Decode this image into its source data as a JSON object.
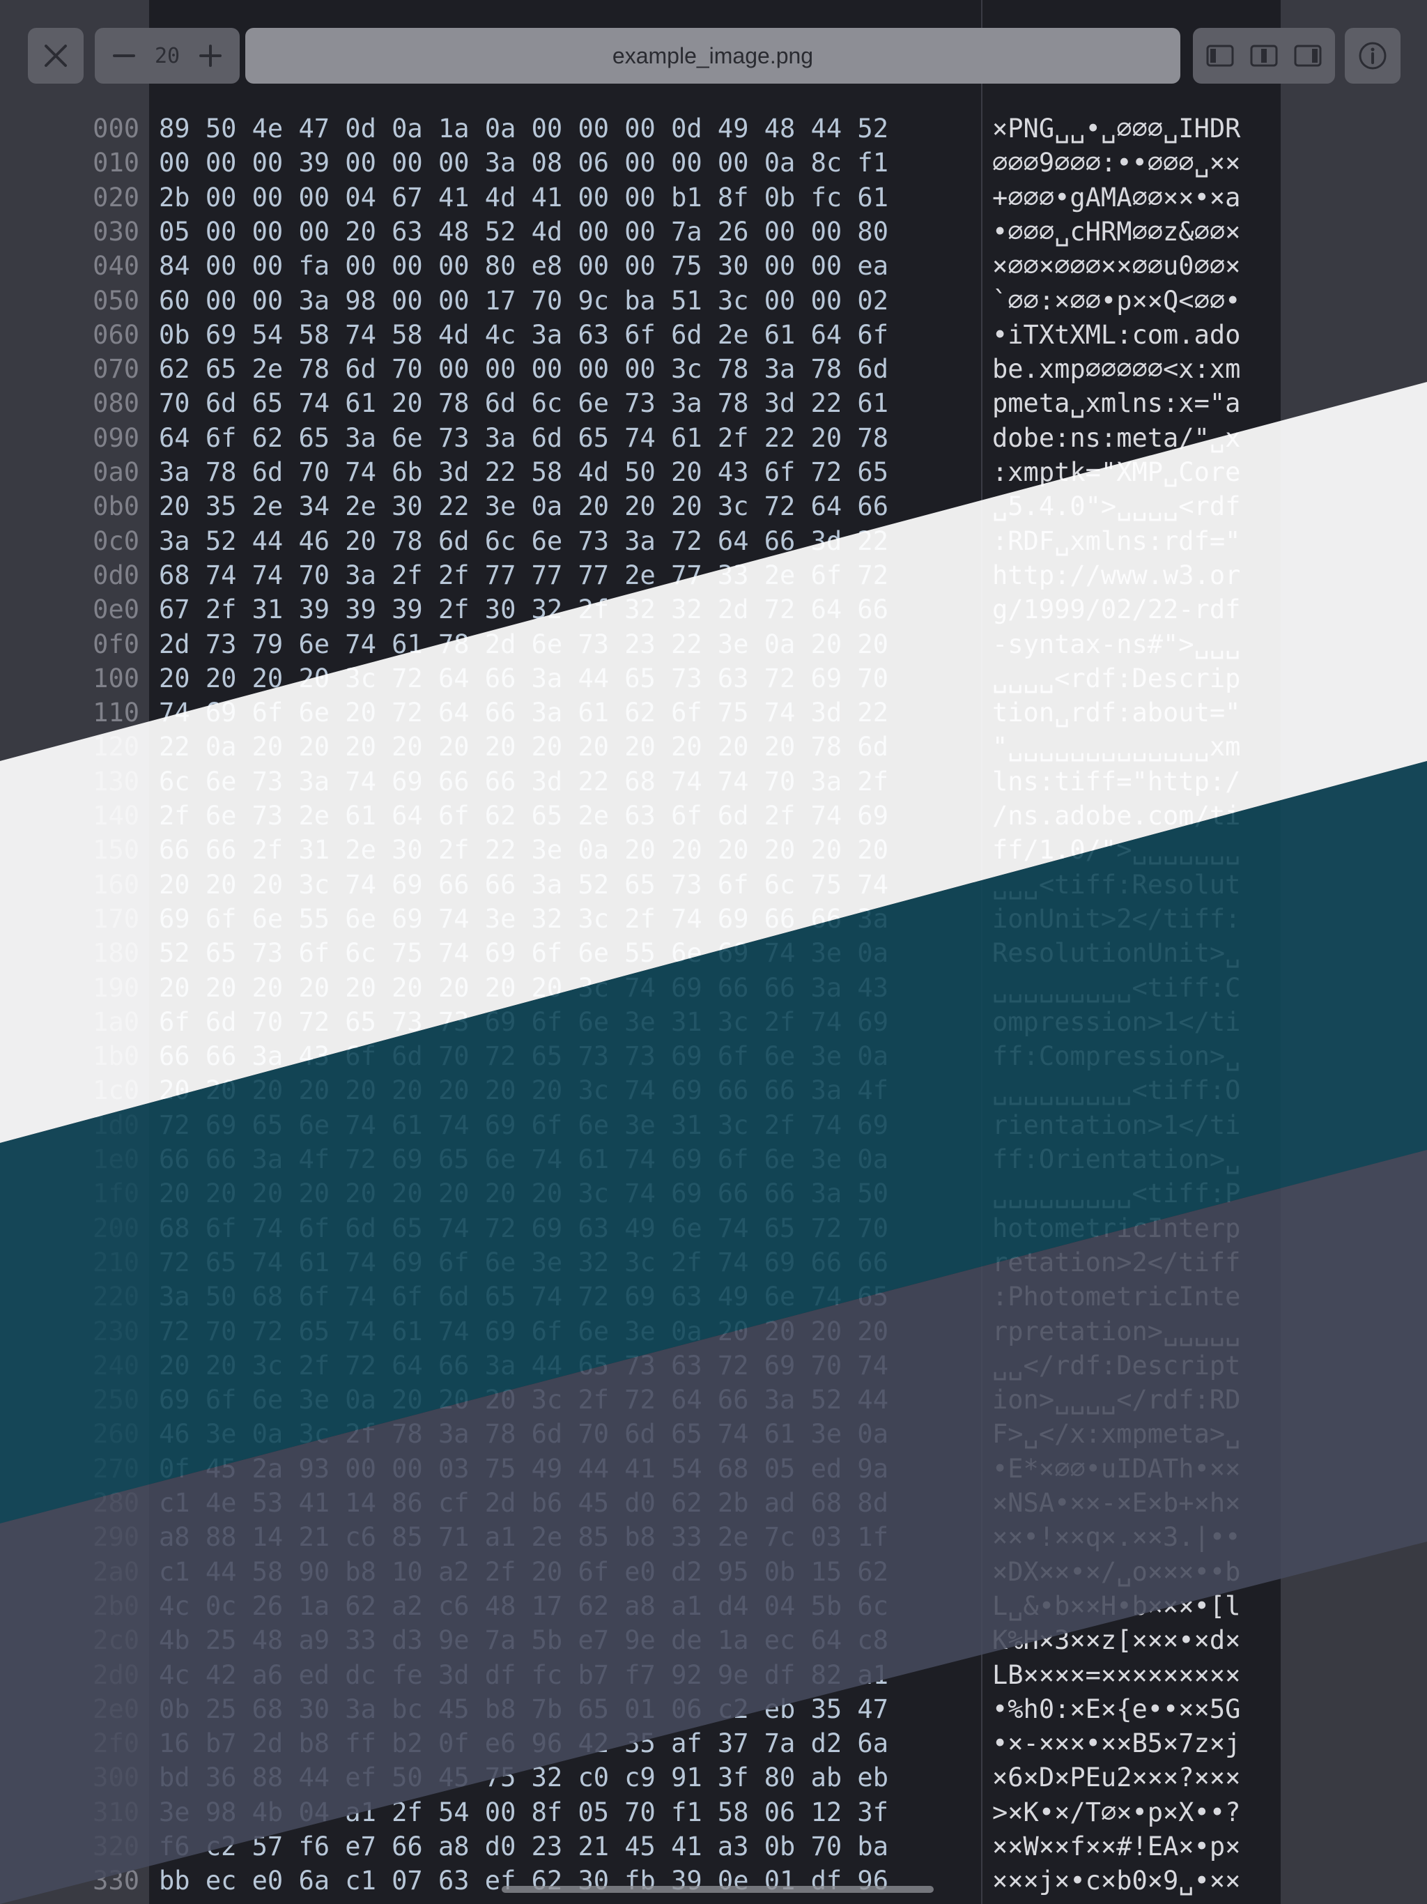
{
  "window": {
    "title": "example_image.png",
    "zoom_value": "20"
  },
  "toolbar": {
    "close_icon": "close-icon",
    "zoom_out_icon": "minus-icon",
    "zoom_in_icon": "plus-icon",
    "layout_icons": [
      "sidebar-left-icon",
      "split-view-icon",
      "sidebar-right-icon"
    ],
    "info_icon": "info-icon"
  },
  "colors": {
    "background": "#1d1e24",
    "offset_text": "#80818a",
    "hex_default": "#b8c7d8",
    "ascii_text": "#d8d9de",
    "stripe_white": "#f2f2f2",
    "stripe_teal": "#12485a",
    "stripe_slate": "#464a5c"
  },
  "rows": [
    {
      "offset": "000",
      "hex": "89 50 4e 47 0d 0a 1a 0a 00 00 00 0d 49 48 44 52",
      "ascii": "×PNG␣␣•␣∅∅∅␣IHDR"
    },
    {
      "offset": "010",
      "hex": "00 00 00 39 00 00 00 3a 08 06 00 00 00 0a 8c f1",
      "ascii": "∅∅∅9∅∅∅:••∅∅∅␣××"
    },
    {
      "offset": "020",
      "hex": "2b 00 00 00 04 67 41 4d 41 00 00 b1 8f 0b fc 61",
      "ascii": "+∅∅∅•gAMA∅∅××•×a"
    },
    {
      "offset": "030",
      "hex": "05 00 00 00 20 63 48 52 4d 00 00 7a 26 00 00 80",
      "ascii": "•∅∅∅␣cHRM∅∅z&∅∅×"
    },
    {
      "offset": "040",
      "hex": "84 00 00 fa 00 00 00 80 e8 00 00 75 30 00 00 ea",
      "ascii": "×∅∅×∅∅∅××∅∅u0∅∅×"
    },
    {
      "offset": "050",
      "hex": "60 00 00 3a 98 00 00 17 70 9c ba 51 3c 00 00 02",
      "ascii": "`∅∅:×∅∅•p××Q<∅∅•"
    },
    {
      "offset": "060",
      "hex": "0b 69 54 58 74 58 4d 4c 3a 63 6f 6d 2e 61 64 6f",
      "ascii": "•iTXtXML:com.ado"
    },
    {
      "offset": "070",
      "hex": "62 65 2e 78 6d 70 00 00 00 00 00 3c 78 3a 78 6d",
      "ascii": "be.xmp∅∅∅∅∅<x:xm"
    },
    {
      "offset": "080",
      "hex": "70 6d 65 74 61 20 78 6d 6c 6e 73 3a 78 3d 22 61",
      "ascii": "pmeta␣xmlns:x=\"a"
    },
    {
      "offset": "090",
      "hex": "64 6f 62 65 3a 6e 73 3a 6d 65 74 61 2f 22 20 78",
      "ascii": "dobe:ns:meta/\"␣x"
    },
    {
      "offset": "0a0",
      "hex": "3a 78 6d 70 74 6b 3d 22 58 4d 50 20 43 6f 72 65",
      "ascii": ":xmptk=\"XMP␣Core"
    },
    {
      "offset": "0b0",
      "hex": "20 35 2e 34 2e 30 22 3e 0a 20 20 20 3c 72 64 66",
      "ascii": "␣5.4.0\">␣␣␣␣<rdf"
    },
    {
      "offset": "0c0",
      "hex": "3a 52 44 46 20 78 6d 6c 6e 73 3a 72 64 66 3d 22",
      "ascii": ":RDF␣xmlns:rdf=\""
    },
    {
      "offset": "0d0",
      "hex": "68 74 74 70 3a 2f 2f 77 77 77 2e 77 33 2e 6f 72",
      "ascii": "http://www.w3.or"
    },
    {
      "offset": "0e0",
      "hex": "67 2f 31 39 39 39 2f 30 32 2f 32 32 2d 72 64 66",
      "ascii": "g/1999/02/22-rdf"
    },
    {
      "offset": "0f0",
      "hex": "2d 73 79 6e 74 61 78 2d 6e 73 23 22 3e 0a 20 20",
      "ascii": "-syntax-ns#\">␣␣␣"
    },
    {
      "offset": "100",
      "hex": "20 20 20 20 3c 72 64 66 3a 44 65 73 63 72 69 70",
      "ascii": "␣␣␣␣<rdf:Descrip"
    },
    {
      "offset": "110",
      "hex": "74 69 6f 6e 20 72 64 66 3a 61 62 6f 75 74 3d 22",
      "ascii": "tion␣rdf:about=\""
    },
    {
      "offset": "120",
      "hex": "22 0a 20 20 20 20 20 20 20 20 20 20 20 20 78 6d",
      "ascii": "\"␣␣␣␣␣␣␣␣␣␣␣␣␣xm"
    },
    {
      "offset": "130",
      "hex": "6c 6e 73 3a 74 69 66 66 3d 22 68 74 74 70 3a 2f",
      "ascii": "lns:tiff=\"http:/"
    },
    {
      "offset": "140",
      "hex": "2f 6e 73 2e 61 64 6f 62 65 2e 63 6f 6d 2f 74 69",
      "ascii": "/ns.adobe.com/ti"
    },
    {
      "offset": "150",
      "hex": "66 66 2f 31 2e 30 2f 22 3e 0a 20 20 20 20 20 20",
      "ascii": "ff/1.0/\">␣␣␣␣␣␣␣"
    },
    {
      "offset": "160",
      "hex": "20 20 20 3c 74 69 66 66 3a 52 65 73 6f 6c 75 74",
      "ascii": "␣␣␣<tiff:Resolut"
    },
    {
      "offset": "170",
      "hex": "69 6f 6e 55 6e 69 74 3e 32 3c 2f 74 69 66 66 3a",
      "ascii": "ionUnit>2</tiff:"
    },
    {
      "offset": "180",
      "hex": "52 65 73 6f 6c 75 74 69 6f 6e 55 6e 69 74 3e 0a",
      "ascii": "ResolutionUnit>␣"
    },
    {
      "offset": "190",
      "hex": "20 20 20 20 20 20 20 20 20 3c 74 69 66 66 3a 43",
      "ascii": "␣␣␣␣␣␣␣␣␣<tiff:C"
    },
    {
      "offset": "1a0",
      "hex": "6f 6d 70 72 65 73 73 69 6f 6e 3e 31 3c 2f 74 69",
      "ascii": "ompression>1</ti"
    },
    {
      "offset": "1b0",
      "hex": "66 66 3a 43 6f 6d 70 72 65 73 73 69 6f 6e 3e 0a",
      "ascii": "ff:Compression>␣"
    },
    {
      "offset": "1c0",
      "hex": "20 20 20 20 20 20 20 20 20 3c 74 69 66 66 3a 4f",
      "ascii": "␣␣␣␣␣␣␣␣␣<tiff:O"
    },
    {
      "offset": "1d0",
      "hex": "72 69 65 6e 74 61 74 69 6f 6e 3e 31 3c 2f 74 69",
      "ascii": "rientation>1</ti"
    },
    {
      "offset": "1e0",
      "hex": "66 66 3a 4f 72 69 65 6e 74 61 74 69 6f 6e 3e 0a",
      "ascii": "ff:Orientation>␣"
    },
    {
      "offset": "1f0",
      "hex": "20 20 20 20 20 20 20 20 20 3c 74 69 66 66 3a 50",
      "ascii": "␣␣␣␣␣␣␣␣␣<tiff:P"
    },
    {
      "offset": "200",
      "hex": "68 6f 74 6f 6d 65 74 72 69 63 49 6e 74 65 72 70",
      "ascii": "hotometricInterp"
    },
    {
      "offset": "210",
      "hex": "72 65 74 61 74 69 6f 6e 3e 32 3c 2f 74 69 66 66",
      "ascii": "retation>2</tiff"
    },
    {
      "offset": "220",
      "hex": "3a 50 68 6f 74 6f 6d 65 74 72 69 63 49 6e 74 65",
      "ascii": ":PhotometricInte"
    },
    {
      "offset": "230",
      "hex": "72 70 72 65 74 61 74 69 6f 6e 3e 0a 20 20 20 20",
      "ascii": "rpretation>␣␣␣␣␣"
    },
    {
      "offset": "240",
      "hex": "20 20 3c 2f 72 64 66 3a 44 65 73 63 72 69 70 74",
      "ascii": "␣␣</rdf:Descript"
    },
    {
      "offset": "250",
      "hex": "69 6f 6e 3e 0a 20 20 20 3c 2f 72 64 66 3a 52 44",
      "ascii": "ion>␣␣␣␣</rdf:RD"
    },
    {
      "offset": "260",
      "hex": "46 3e 0a 3c 2f 78 3a 78 6d 70 6d 65 74 61 3e 0a",
      "ascii": "F>␣</x:xmpmeta>␣"
    },
    {
      "offset": "270",
      "hex": "0f 45 2a 93 00 00 03 75 49 44 41 54 68 05 ed 9a",
      "ascii": "•E*×∅∅•uIDATh•××"
    },
    {
      "offset": "280",
      "hex": "c1 4e 53 41 14 86 cf 2d b6 45 d0 62 2b ad 68 8d",
      "ascii": "×NSA•××-×E×b+×h×"
    },
    {
      "offset": "290",
      "hex": "a8 88 14 21 c6 85 71 a1 2e 85 b8 33 2e 7c 03 1f",
      "ascii": "××•!××q×.××3.|••"
    },
    {
      "offset": "2a0",
      "hex": "c1 44 58 90 b8 10 a2 2f 20 6f e0 d2 95 0b 15 62",
      "ascii": "×DX××•×/␣o×××••b"
    },
    {
      "offset": "2b0",
      "hex": "4c 0c 26 1a 62 a2 c6 48 17 62 a8 a1 d4 04 5b 6c",
      "ascii": "L␣&•b××H•b×××•[l"
    },
    {
      "offset": "2c0",
      "hex": "4b 25 48 a9 33 d3 9e 7a 5b e7 9e de 1a ec 64 c8",
      "ascii": "K%H×3××z[×××•×d×"
    },
    {
      "offset": "2d0",
      "hex": "4c 42 a6 ed dc fe 3d df fc b7 f7 92 9e df 82 a1",
      "ascii": "LB××××=×××××××××"
    },
    {
      "offset": "2e0",
      "hex": "0b 25 68 30 3a bc 45 b8 7b 65 01 06 c2 eb 35 47",
      "ascii": "•%h0:×E×{e••××5G"
    },
    {
      "offset": "2f0",
      "hex": "16 b7 2d b8 ff b2 0f e6 96 42 35 af 37 7a d2 6a",
      "ascii": "•×-×××•××B5×7z×j"
    },
    {
      "offset": "300",
      "hex": "bd 36 88 44 ef 50 45 75 32 c0 c9 91 3f 80 ab eb",
      "ascii": "×6×D×PEu2×××?×××"
    },
    {
      "offset": "310",
      "hex": "3e 98 4b 04 a1 2f 54 00 8f 05 70 f1 58 06 12 3f",
      "ascii": ">×K•×/T∅×•p×X••?"
    },
    {
      "offset": "320",
      "hex": "f6 c2 57 f6 e7 66 a8 d0 23 21 45 41 a3 0b 70 ba",
      "ascii": "××W××f××#!EA×•p×"
    },
    {
      "offset": "330",
      "hex": "bb ec e0 6a c1 07 63 ef 62 30 fb 39 0e 01 df 96",
      "ascii": "×××j×•c×b0×9␣•××"
    }
  ]
}
